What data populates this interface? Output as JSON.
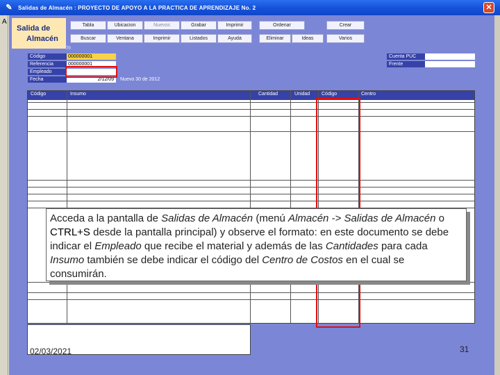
{
  "window": {
    "title": "Salidas de Almacén : PROYECTO DE APOYO A LA PRACTICA DE APRENDIZAJE No. 2",
    "close_glyph": "✕",
    "app_icon_glyph": "✎",
    "outer_letter": "A"
  },
  "logo": {
    "line1": "Salida de",
    "line2": "Almacén"
  },
  "toolbar": {
    "row1": [
      "Tabla",
      "Ubicacion",
      "Nuevos",
      "Grabar",
      "Imprimir",
      "Ordenar",
      "Crear"
    ],
    "row2": [
      "Buscar",
      "Ventana",
      "Imprimir",
      "Listados",
      "Ayuda",
      "Eliminar",
      "Ideas",
      "Varios"
    ]
  },
  "header_fields": {
    "small_top": "70",
    "codigo_label": "Código",
    "codigo_value": "000000001",
    "referencia_label": "Referencia",
    "referencia_value": "000000001",
    "empleado_label": "Empleado",
    "empleado_value": "",
    "fecha_label": "Fecha",
    "fecha_value": "2/12/09",
    "fecha_text": "Nuevo 30 de 2012",
    "cuenta_label": "Cuenta PUC",
    "cuenta_value": "",
    "frente_label": "Frente",
    "frente_value": ""
  },
  "grid": {
    "columns": [
      "Código",
      "Insumo",
      "Cantidad",
      "Unidad",
      "Código",
      "Centro"
    ]
  },
  "note": {
    "p1": "Acceda a la pantalla de ",
    "e1": "Salidas de Almacén",
    "p2": " (menú ",
    "e2": "Almacén -> Salidas de Almacén",
    "p3": " o ",
    "k1": "CTRL+S",
    "p4": " desde la pantalla principal) y observe el formato: en este documento se debe indicar el ",
    "e3": "Empleado",
    "p5": " que recibe el material y además de las ",
    "e4": "Cantidades",
    "p6": " para cada ",
    "e5": "Insumo",
    "p7": " también se debe indicar el código del ",
    "e6": "Centro de Costos",
    "p8": " en el cual se consumirán."
  },
  "footer": {
    "date": "02/03/2021",
    "page": "31"
  },
  "colors": {
    "form_bg": "#7b86d6",
    "header_blue": "#3642a8",
    "highlight_red": "#e01010",
    "yellow_field": "#f7d24a"
  }
}
